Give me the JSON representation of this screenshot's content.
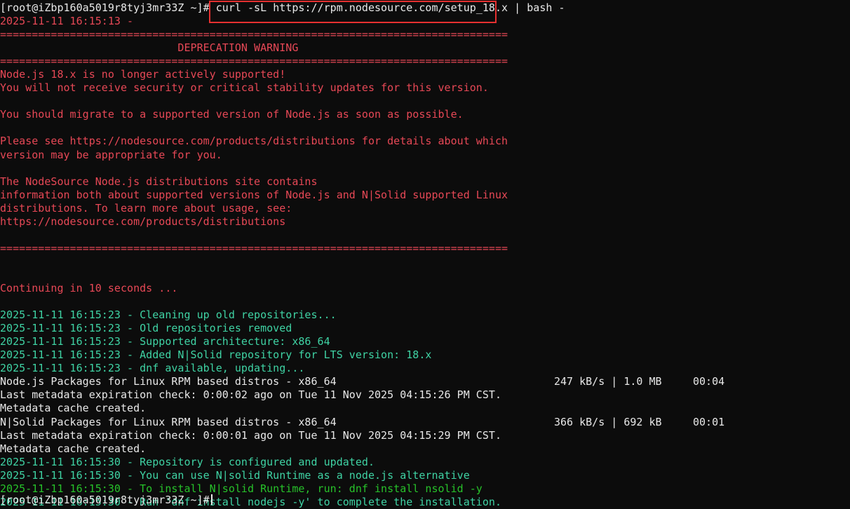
{
  "terminal": {
    "prompt": "[root@iZbp160a5019r8tyj3mr33Z ~]#",
    "command": " curl -sL https://rpm.nodesource.com/setup_18.x | bash -",
    "output": [
      {
        "text": "2025-11-11 16:15:13 -",
        "color": "red"
      },
      {
        "text": "================================================================================",
        "color": "red"
      },
      {
        "text": "                            DEPRECATION WARNING",
        "color": "red"
      },
      {
        "text": "================================================================================",
        "color": "red"
      },
      {
        "text": "Node.js 18.x is no longer actively supported!",
        "color": "red"
      },
      {
        "text": "You will not receive security or critical stability updates for this version.",
        "color": "red"
      },
      {
        "text": "",
        "color": "red"
      },
      {
        "text": "You should migrate to a supported version of Node.js as soon as possible.",
        "color": "red"
      },
      {
        "text": "",
        "color": "red"
      },
      {
        "text": "Please see https://nodesource.com/products/distributions for details about which",
        "color": "red"
      },
      {
        "text": "version may be appropriate for you.",
        "color": "red"
      },
      {
        "text": "",
        "color": "red"
      },
      {
        "text": "The NodeSource Node.js distributions site contains",
        "color": "red"
      },
      {
        "text": "information both about supported versions of Node.js and N|Solid supported Linux",
        "color": "red"
      },
      {
        "text": "distributions. To learn more about usage, see:",
        "color": "red"
      },
      {
        "text": "https://nodesource.com/products/distributions",
        "color": "red"
      },
      {
        "text": "",
        "color": "red"
      },
      {
        "text": "================================================================================",
        "color": "red"
      },
      {
        "text": "",
        "color": "red"
      },
      {
        "text": "",
        "color": "red"
      },
      {
        "text": "Continuing in 10 seconds ...",
        "color": "red"
      },
      {
        "text": "",
        "color": "red"
      },
      {
        "text": "2025-11-11 16:15:23 - Cleaning up old repositories...",
        "color": "teal"
      },
      {
        "text": "2025-11-11 16:15:23 - Old repositories removed",
        "color": "teal"
      },
      {
        "text": "2025-11-11 16:15:23 - Supported architecture: x86_64",
        "color": "teal"
      },
      {
        "text": "2025-11-11 16:15:23 - Added N|Solid repository for LTS version: 18.x",
        "color": "teal"
      },
      {
        "text": "2025-11-11 16:15:23 - dnf available, updating...",
        "color": "teal"
      },
      {
        "text": "Node.js Packages for Linux RPM based distros - x86_64",
        "color": "white"
      },
      {
        "text": "Last metadata expiration check: 0:00:02 ago on Tue 11 Nov 2025 04:15:26 PM CST.",
        "color": "white"
      },
      {
        "text": "Metadata cache created.",
        "color": "white"
      },
      {
        "text": "N|Solid Packages for Linux RPM based distros - x86_64",
        "color": "white"
      },
      {
        "text": "Last metadata expiration check: 0:00:01 ago on Tue 11 Nov 2025 04:15:29 PM CST.",
        "color": "white"
      },
      {
        "text": "Metadata cache created.",
        "color": "white"
      },
      {
        "text": "2025-11-11 16:15:30 - Repository is configured and updated.",
        "color": "teal"
      },
      {
        "text": "2025-11-11 16:15:30 - You can use N|solid Runtime as a node.js alternative",
        "color": "teal"
      },
      {
        "text": "2025-11-11 16:15:30 - To install N|solid Runtime, run: dnf install nsolid -y",
        "color": "green"
      },
      {
        "text": "2025-11-11 16:15:30 - Run 'dnf install nodejs -y' to complete the installation.",
        "color": "teal"
      }
    ],
    "downloads": [
      {
        "line": 27,
        "rate": "247 kB/s | 1.0 MB",
        "time": "00:04"
      },
      {
        "line": 30,
        "rate": "366 kB/s | 692 kB",
        "time": "00:01"
      }
    ],
    "final_prompt": "[root@iZbp160a5019r8tyj3mr33Z ~]#"
  },
  "colors": {
    "background": "#0c0c0c",
    "foreground": "#e8e8e8",
    "red": "#e74856",
    "teal": "#3fd3a4",
    "green": "#27c22a",
    "highlight_box": "#e53030"
  }
}
